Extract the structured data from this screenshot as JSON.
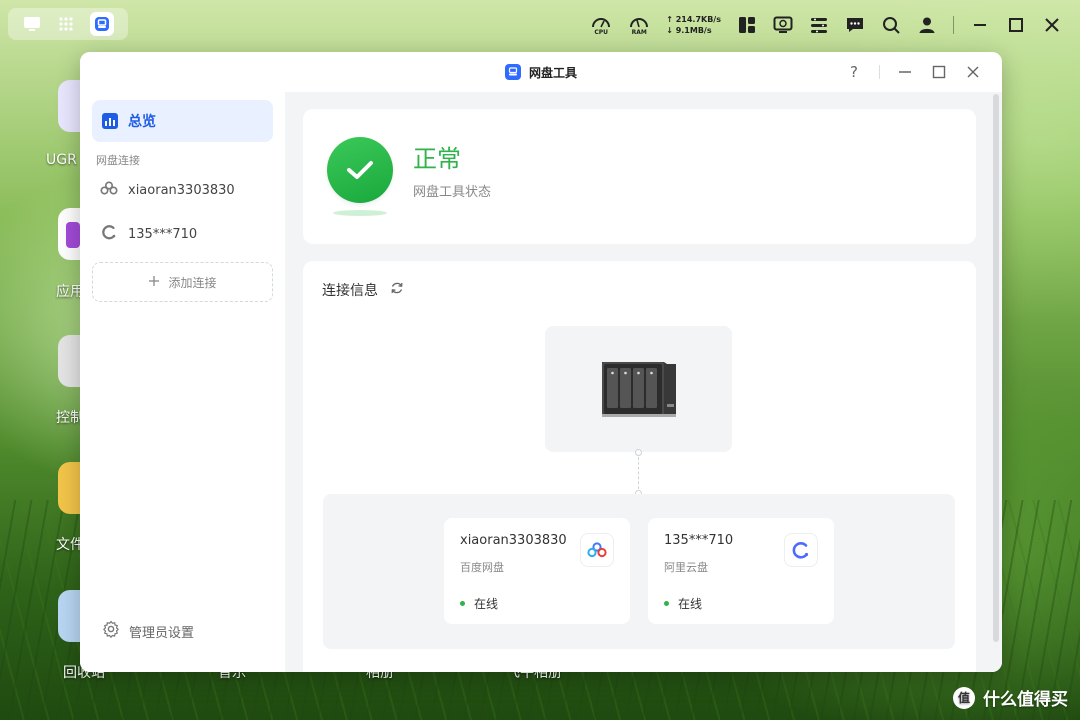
{
  "taskbar": {
    "left_icons": [
      "desktop-icon",
      "apps-grid-icon",
      "netdisk-app-icon"
    ],
    "cpu_label": "CPU",
    "ram_label": "RAM",
    "upload_speed": "214.7KB/s",
    "download_speed": "9.1MB/s",
    "right_icons": [
      "widgets-icon",
      "monitor-icon",
      "control-icon",
      "message-icon",
      "search-icon",
      "user-icon"
    ]
  },
  "desktop": {
    "labels": [
      "UGR",
      "应用",
      "控制",
      "文件",
      "回收站",
      "音乐",
      "相册",
      "飞牛相册"
    ]
  },
  "window": {
    "title": "网盘工具",
    "controls": {
      "help": "?",
      "minimize": "—",
      "maximize": "☐",
      "close": "✕"
    }
  },
  "sidebar": {
    "overview_label": "总览",
    "section_label": "网盘连接",
    "connections": [
      {
        "label": "xiaoran3303830",
        "icon": "baidu-cloud-icon"
      },
      {
        "label": "135***710",
        "icon": "aliyun-drive-icon"
      }
    ],
    "add_connection_label": "添加连接",
    "admin_settings_label": "管理员设置"
  },
  "status": {
    "title": "正常",
    "subtitle": "网盘工具状态",
    "color": "#2fb34a"
  },
  "connection_info": {
    "title": "连接信息",
    "drives": [
      {
        "name": "xiaoran3303830",
        "type": "百度网盘",
        "status": "在线",
        "icon": "baidu-cloud-icon"
      },
      {
        "name": "135***710",
        "type": "阿里云盘",
        "status": "在线",
        "icon": "aliyun-drive-icon"
      }
    ]
  },
  "watermark": {
    "text": "什么值得买",
    "icon_char": "值"
  },
  "colors": {
    "accent": "#1f5ce6",
    "online": "#2fb34a",
    "main_bg": "#f3f4f6"
  }
}
